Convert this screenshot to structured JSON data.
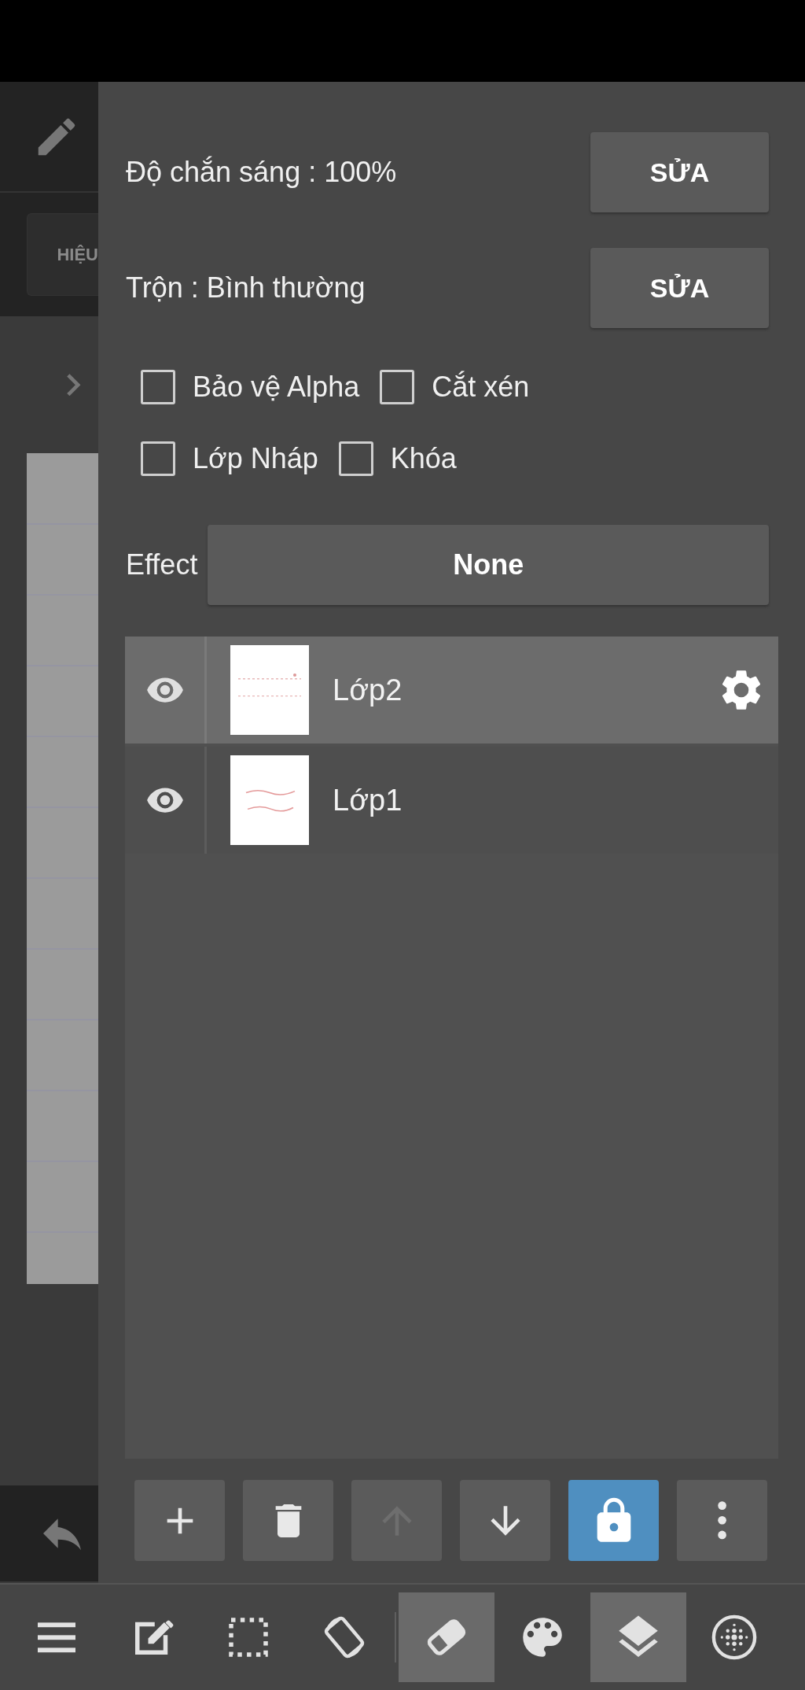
{
  "side": {
    "tab": "HIỆU"
  },
  "opacity": {
    "label": "Độ chắn sáng : 100%",
    "button": "SỬA"
  },
  "blend": {
    "label": "Trộn : Bình thường",
    "button": "SỬA"
  },
  "options": [
    [
      {
        "label": "Bảo vệ Alpha",
        "checked": false
      },
      {
        "label": "Cắt xén",
        "checked": false
      }
    ],
    [
      {
        "label": "Lớp Nháp",
        "checked": false
      },
      {
        "label": "Khóa",
        "checked": false
      }
    ]
  ],
  "effect": {
    "label": "Effect",
    "value": "None"
  },
  "layers": [
    {
      "name": "Lớp2",
      "visible": true,
      "selected": true
    },
    {
      "name": "Lớp1",
      "visible": true,
      "selected": false
    }
  ],
  "layer_actions": [
    {
      "kind": "add",
      "disabled": false,
      "on": false
    },
    {
      "kind": "delete",
      "disabled": false,
      "on": false
    },
    {
      "kind": "up",
      "disabled": true,
      "on": false
    },
    {
      "kind": "down",
      "disabled": false,
      "on": false
    },
    {
      "kind": "lock",
      "disabled": false,
      "on": true
    },
    {
      "kind": "more",
      "disabled": false,
      "on": false
    }
  ],
  "toolbar": [
    {
      "kind": "menu",
      "selected": false
    },
    {
      "kind": "edit",
      "selected": false
    },
    {
      "kind": "select",
      "selected": false
    },
    {
      "kind": "rotate",
      "selected": false
    },
    {
      "kind": "eraser",
      "selected": true
    },
    {
      "kind": "palette",
      "selected": false
    },
    {
      "kind": "layers",
      "selected": true
    },
    {
      "kind": "dots",
      "selected": false
    }
  ]
}
